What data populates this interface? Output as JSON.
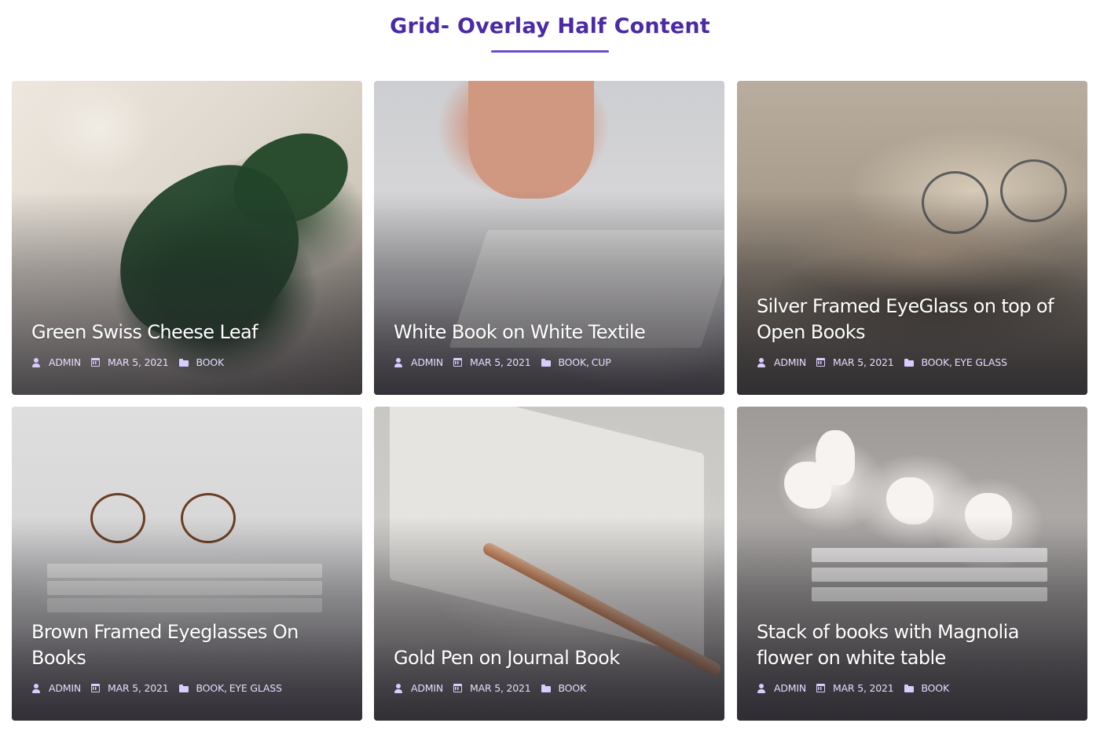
{
  "section": {
    "title": "Grid- Overlay Half Content"
  },
  "colors": {
    "title": "#4b2aa6",
    "underline": "#6a4fc8",
    "meta": "#e6dcff"
  },
  "icons": {
    "author": "user-icon",
    "date": "calendar-icon",
    "category": "folder-icon"
  },
  "cards": [
    {
      "title": "Green Swiss Cheese Leaf",
      "author": "ADMIN",
      "date": "MAR 5, 2021",
      "categories": [
        "BOOK"
      ]
    },
    {
      "title": "White Book on White Textile",
      "author": "ADMIN",
      "date": "MAR 5, 2021",
      "categories": [
        "BOOK",
        "CUP"
      ]
    },
    {
      "title": "Silver Framed EyeGlass on top of Open Books",
      "author": "ADMIN",
      "date": "MAR 5, 2021",
      "categories": [
        "BOOK",
        "EYE GLASS"
      ]
    },
    {
      "title": "Brown Framed Eyeglasses On Books",
      "author": "ADMIN",
      "date": "MAR 5, 2021",
      "categories": [
        "BOOK",
        "EYE GLASS"
      ]
    },
    {
      "title": "Gold Pen on Journal Book",
      "author": "ADMIN",
      "date": "MAR 5, 2021",
      "categories": [
        "BOOK"
      ]
    },
    {
      "title": "Stack of books with Magnolia flower on white table",
      "author": "ADMIN",
      "date": "MAR 5, 2021",
      "categories": [
        "BOOK"
      ]
    }
  ]
}
